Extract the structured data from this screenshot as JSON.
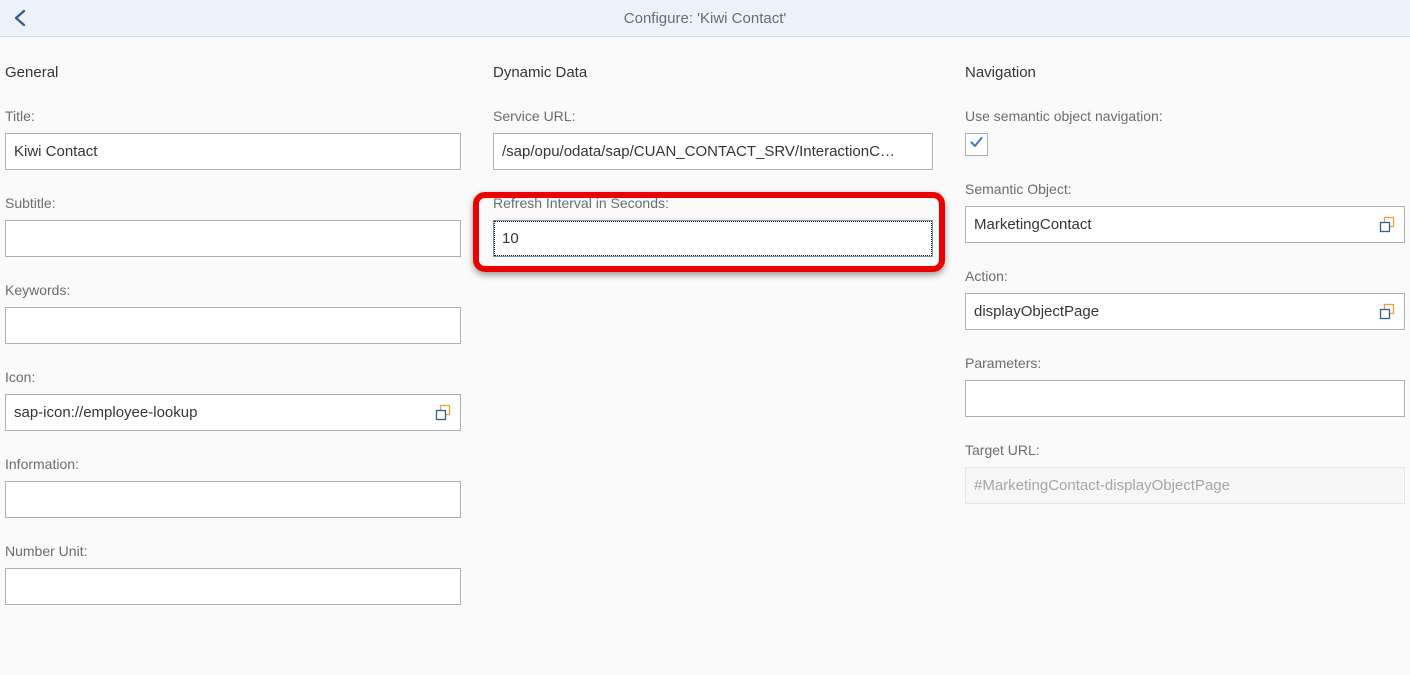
{
  "header": {
    "back_icon": "chevron-left-icon",
    "title": "Configure: 'Kiwi Contact'"
  },
  "general": {
    "section_title": "General",
    "fields": [
      {
        "label": "Title:",
        "value": "Kiwi Contact",
        "value_help": false,
        "readonly": false
      },
      {
        "label": "Subtitle:",
        "value": "",
        "value_help": false,
        "readonly": false
      },
      {
        "label": "Keywords:",
        "value": "",
        "value_help": false,
        "readonly": false
      },
      {
        "label": "Icon:",
        "value": "sap-icon://employee-lookup",
        "value_help": true,
        "readonly": false
      },
      {
        "label": "Information:",
        "value": "",
        "value_help": false,
        "readonly": false
      },
      {
        "label": "Number Unit:",
        "value": "",
        "value_help": false,
        "readonly": false
      }
    ]
  },
  "dynamic_data": {
    "section_title": "Dynamic Data",
    "service_url": {
      "label": "Service URL:",
      "value": "/sap/opu/odata/sap/CUAN_CONTACT_SRV/InteractionC…"
    },
    "refresh_interval": {
      "label": "Refresh Interval in Seconds:",
      "value": "10"
    }
  },
  "navigation": {
    "section_title": "Navigation",
    "semantic_nav": {
      "label": "Use semantic object navigation:",
      "checked": true,
      "check_icon": "checkmark-icon"
    },
    "semantic_object": {
      "label": "Semantic Object:",
      "value": "MarketingContact",
      "value_help_icon": "value-help-icon"
    },
    "action": {
      "label": "Action:",
      "value": "displayObjectPage",
      "value_help_icon": "value-help-icon"
    },
    "parameters": {
      "label": "Parameters:",
      "value": ""
    },
    "target_url": {
      "label": "Target URL:",
      "value": "#MarketingContact-displayObjectPage"
    }
  },
  "annotation": {
    "highlight_color": "#ee0000",
    "target": "refresh-interval-field"
  },
  "colors": {
    "header_bg": "#edf1f9",
    "page_bg": "#fafafa",
    "label_text": "#6a6d70",
    "value_text": "#32363a",
    "input_border": "#a9b0b6",
    "accent_blue": "#346187",
    "vh_orange": "#e8a33d"
  }
}
